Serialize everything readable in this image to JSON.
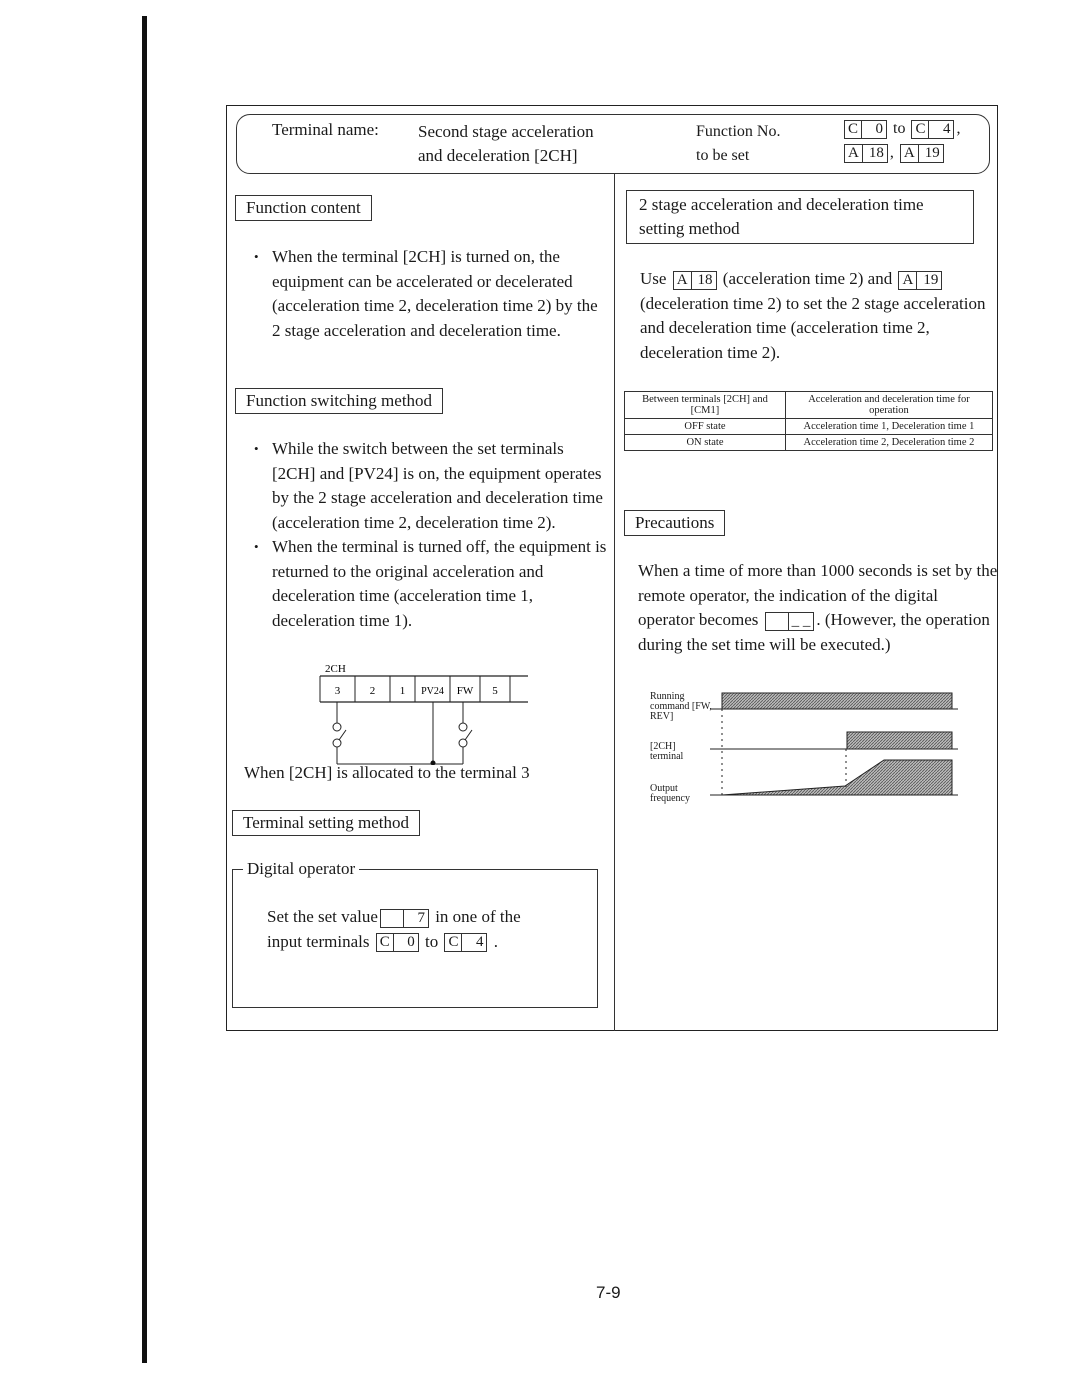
{
  "header": {
    "terminal_name_label": "Terminal name:",
    "terminal_name_line1": "Second stage acceleration",
    "terminal_name_line2": "and deceleration [2CH]",
    "function_no_line1": "Function No.",
    "function_no_line2": "to be set",
    "codes_line1": [
      {
        "a": "C",
        "b": "0"
      },
      {
        "sep": "to"
      },
      {
        "a": "C",
        "b": "4"
      }
    ],
    "codes_line2": [
      {
        "a": "A",
        "b": "18"
      },
      {
        "a": "A",
        "b": "19"
      }
    ],
    "to_word": "to"
  },
  "left": {
    "function_content": {
      "title": "Function content",
      "bullets": [
        "When the terminal [2CH] is turned on, the equipment can be accelerated or decelerated (acceleration time 2, deceleration time 2) by the 2 stage acceleration and deceleration time."
      ]
    },
    "function_switching": {
      "title": "Function switching method",
      "bullets": [
        "While the switch between the set terminals [2CH] and [PV24] is on, the equipment operates by the 2 stage acceleration and deceleration time (acceleration time 2, deceleration time 2).",
        "When the terminal is turned off, the equipment is returned to the original acceleration and deceleration time (acceleration time 1, deceleration time 1)."
      ]
    },
    "wiring": {
      "top_label": "2CH",
      "terminals": [
        "3",
        "2",
        "1",
        "PV24",
        "FW",
        "5"
      ],
      "caption": "When [2CH] is allocated to the terminal 3"
    },
    "terminal_setting": {
      "title": "Terminal setting method",
      "digital_operator_label": "Digital operator",
      "line1_prefix": "Set the set value",
      "set_value": {
        "a": "",
        "b": "7"
      },
      "line1_suffix": "in one of the",
      "line2_prefix": "input terminals",
      "from_code": {
        "a": "C",
        "b": "0"
      },
      "to_word": "to",
      "to_code": {
        "a": "C",
        "b": "4"
      },
      "line2_suffix": "."
    }
  },
  "right": {
    "setting_method": {
      "title": "2 stage acceleration and deceleration time setting method",
      "use_word": "Use",
      "code1": {
        "a": "A",
        "b": "18"
      },
      "text1": "(acceleration time 2) and",
      "code2": {
        "a": "A",
        "b": "19"
      },
      "text2": "(deceleration time 2) to set the 2 stage acceleration and deceleration time (acceleration time 2, deceleration time 2)."
    },
    "table": {
      "headers": [
        "Between terminals [2CH] and [CM1]",
        "Acceleration and deceleration time for operation"
      ],
      "rows": [
        [
          "OFF state",
          "Acceleration time 1, Deceleration time 1"
        ],
        [
          "ON state",
          "Acceleration time 2, Deceleration time 2"
        ]
      ]
    },
    "precautions": {
      "title": "Precautions",
      "text_before": "When a time of more than 1000 seconds is set by the remote operator, the indication of the digital operator becomes",
      "display_value": {
        "a": "",
        "b": "_ _"
      },
      "text_after": ". (However, the operation during the set time will be executed.)"
    },
    "timing_chart": {
      "signals": [
        "Running command [FW, REV]",
        "[2CH] terminal",
        "Output frequency"
      ]
    }
  },
  "footer": {
    "page_number": "7-9"
  }
}
